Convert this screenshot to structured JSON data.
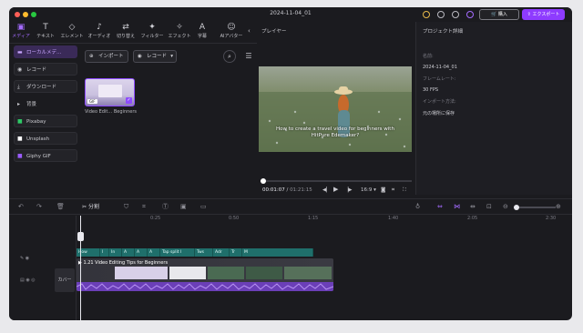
{
  "window": {
    "title": "2024-11-04_01"
  },
  "header": {
    "buy_label": "購入",
    "export_label": "エクスポート"
  },
  "toolbar": {
    "tools": [
      {
        "label": "メディア",
        "icon": "media-icon"
      },
      {
        "label": "テキスト",
        "icon": "text-icon"
      },
      {
        "label": "エレメント",
        "icon": "elements-icon"
      },
      {
        "label": "オーディオ",
        "icon": "audio-icon"
      },
      {
        "label": "切り替え",
        "icon": "transition-icon"
      },
      {
        "label": "フィルター",
        "icon": "filter-icon"
      },
      {
        "label": "エフェクト",
        "icon": "effects-icon"
      },
      {
        "label": "字幕",
        "icon": "subtitle-icon"
      },
      {
        "label": "AIアバター",
        "icon": "ai-avatar-icon"
      }
    ]
  },
  "sidebar": {
    "items": [
      {
        "label": "ローカルメデ…",
        "icon": "folder-icon"
      },
      {
        "label": "レコード",
        "icon": "record-icon"
      },
      {
        "label": "ダウンロード",
        "icon": "download-icon"
      },
      {
        "label": "背景",
        "icon": "chevron-right-icon"
      },
      {
        "label": "Pixabay",
        "icon": "pixabay-icon"
      },
      {
        "label": "Unsplash",
        "icon": "unsplash-icon"
      },
      {
        "label": "Giphy GIF",
        "icon": "giphy-icon"
      }
    ]
  },
  "media": {
    "import_label": "インポート",
    "record_label": "レコード",
    "thumb_caption": "Video Edit… Beginners",
    "thumb_badge": "GIF"
  },
  "player": {
    "title": "プレイヤー",
    "subtitle_line1": "How to create a travel video for beginners with",
    "subtitle_line2": "HitPure Edemaker?",
    "current_time": "00:01:07",
    "total_time": "01:21:15",
    "aspect": "16:9",
    "progress": 0.02
  },
  "project": {
    "title": "プロジェクト詳細",
    "name_label": "名前:",
    "name_value": "2024-11-04_01",
    "fps_label": "フレームレート:",
    "fps_value": "30 FPS",
    "import_label": "インポート方法:",
    "import_value": "元の場所に保存"
  },
  "timeline": {
    "split_label": "分割",
    "ruler": [
      "0:25",
      "0:50",
      "1:15",
      "1:40",
      "2:05",
      "2:30"
    ],
    "text_clips": [
      "How",
      "l",
      "In",
      "A",
      "A",
      "A",
      "Tap split l",
      "Tws",
      "Adr",
      "Tr",
      "M"
    ],
    "video_title": "1.21 Video Editing Tips for Beginners",
    "cover_label": "カバー"
  },
  "colors": {
    "accent": "#8e3bff",
    "text_track": "#1f6f6b",
    "audio": "#7b46d0"
  }
}
